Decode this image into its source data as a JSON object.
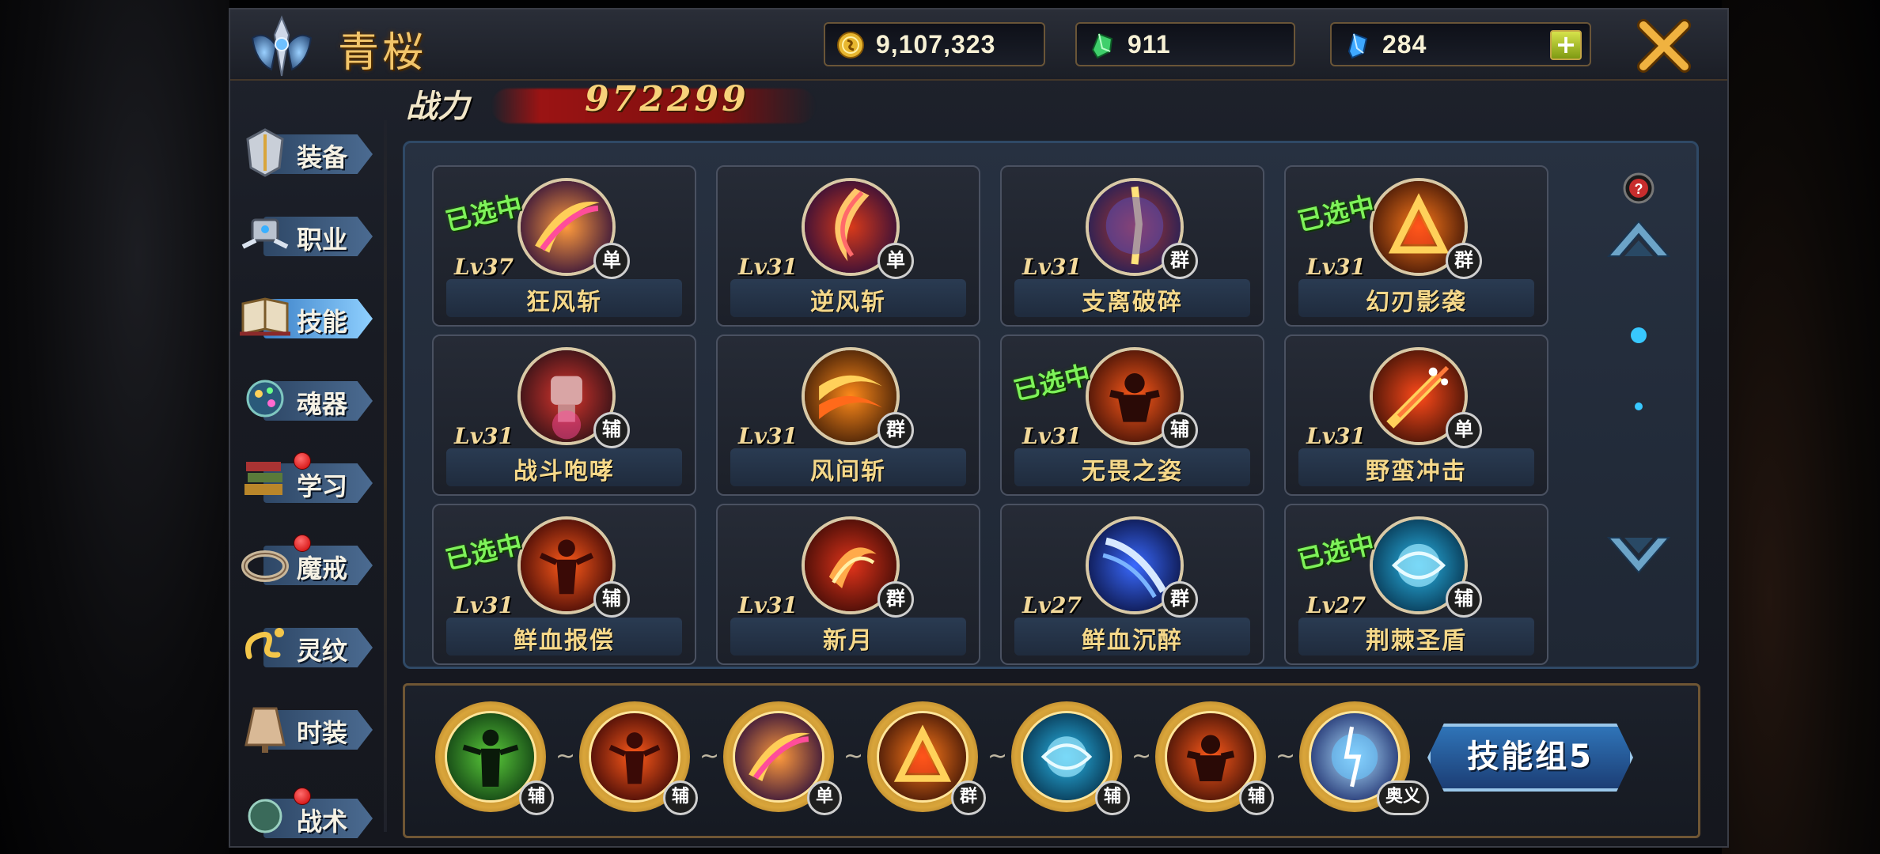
{
  "player": {
    "name": "青桜"
  },
  "currency": {
    "gold": "9,107,323",
    "green_gem": "911",
    "blue_gem": "284"
  },
  "power": {
    "label": "战力",
    "value": "972299"
  },
  "nav": [
    {
      "label": "装备",
      "icon": "armor-icon",
      "badge": false,
      "active": false
    },
    {
      "label": "职业",
      "icon": "mech-icon",
      "badge": false,
      "active": false
    },
    {
      "label": "技能",
      "icon": "spellbook-icon",
      "badge": false,
      "active": true
    },
    {
      "label": "魂器",
      "icon": "soul-orb-icon",
      "badge": false,
      "active": false
    },
    {
      "label": "学习",
      "icon": "books-icon",
      "badge": true,
      "active": false
    },
    {
      "label": "魔戒",
      "icon": "ring-icon",
      "badge": true,
      "active": false
    },
    {
      "label": "灵纹",
      "icon": "rune-icon",
      "badge": false,
      "active": false
    },
    {
      "label": "时装",
      "icon": "costume-icon",
      "badge": false,
      "active": false
    },
    {
      "label": "战术",
      "icon": "tactics-icon",
      "badge": true,
      "active": false
    }
  ],
  "selected_label": "已选中",
  "skills": [
    {
      "name": "狂风斩",
      "level": "Lv37",
      "tag": "单",
      "selected": true,
      "icon": "slash-icon"
    },
    {
      "name": "逆风斩",
      "level": "Lv31",
      "tag": "单",
      "selected": false,
      "icon": "crescent-slash-icon"
    },
    {
      "name": "支离破碎",
      "level": "Lv31",
      "tag": "群",
      "selected": false,
      "icon": "shatter-icon"
    },
    {
      "name": "幻刃影袭",
      "level": "Lv31",
      "tag": "群",
      "selected": true,
      "icon": "triangle-blade-icon"
    },
    {
      "name": "战斗咆哮",
      "level": "Lv31",
      "tag": "辅",
      "selected": false,
      "icon": "fist-icon"
    },
    {
      "name": "风间斩",
      "level": "Lv31",
      "tag": "群",
      "selected": false,
      "icon": "fire-slash-icon"
    },
    {
      "name": "无畏之姿",
      "level": "Lv31",
      "tag": "辅",
      "selected": true,
      "icon": "fire-warrior-icon"
    },
    {
      "name": "野蛮冲击",
      "level": "Lv31",
      "tag": "单",
      "selected": false,
      "icon": "charge-icon"
    },
    {
      "name": "鲜血报偿",
      "level": "Lv31",
      "tag": "辅",
      "selected": true,
      "icon": "blood-figure-icon"
    },
    {
      "name": "新月",
      "level": "Lv31",
      "tag": "群",
      "selected": false,
      "icon": "new-moon-icon"
    },
    {
      "name": "鲜血沉醉",
      "level": "Lv27",
      "tag": "群",
      "selected": false,
      "icon": "blue-slash-icon"
    },
    {
      "name": "荆棘圣盾",
      "level": "Lv27",
      "tag": "辅",
      "selected": true,
      "icon": "shield-orb-icon"
    }
  ],
  "loadout": [
    {
      "tag": "辅",
      "icon": "green-figure-icon"
    },
    {
      "tag": "辅",
      "icon": "blood-figure-icon"
    },
    {
      "tag": "单",
      "icon": "slash-icon"
    },
    {
      "tag": "群",
      "icon": "triangle-blade-icon"
    },
    {
      "tag": "辅",
      "icon": "shield-orb-icon"
    },
    {
      "tag": "辅",
      "icon": "fire-warrior-icon"
    },
    {
      "tag": "奥义",
      "icon": "lightning-orb-icon"
    }
  ],
  "loadout_separator": "~",
  "skill_group_button": "技能组5"
}
